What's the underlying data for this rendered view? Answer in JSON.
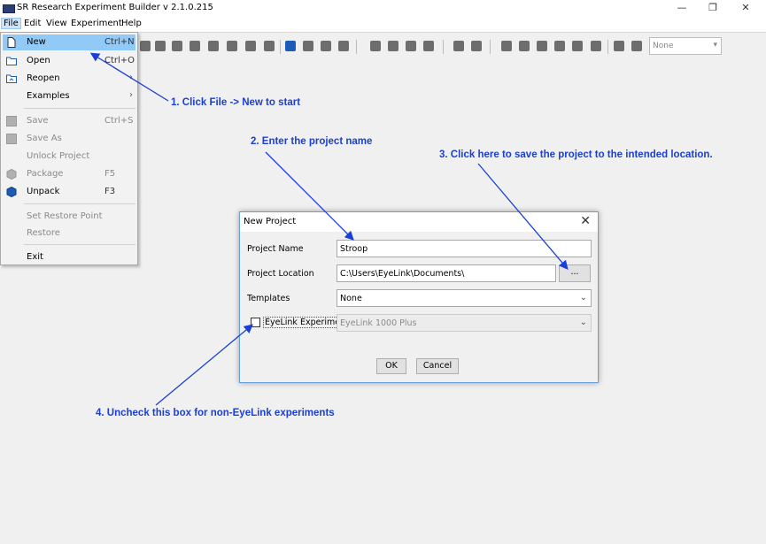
{
  "window": {
    "title": "SR Research Experiment Builder v 2.1.0.215",
    "minimize": "—",
    "maximize": "❐",
    "close": "✕"
  },
  "menubar": [
    "File",
    "Edit",
    "View",
    "Experiment",
    "Help"
  ],
  "toolbar": {
    "combo_value": "None"
  },
  "file_menu": {
    "items": [
      {
        "label": "New",
        "shortcut": "Ctrl+N",
        "icon": "new-document-icon"
      },
      {
        "label": "Open",
        "shortcut": "Ctrl+O",
        "icon": "open-folder-icon"
      },
      {
        "label": "Reopen",
        "submenu": "›",
        "icon": "reopen-icon"
      },
      {
        "label": "Examples",
        "submenu": "›"
      },
      {
        "label": "Save",
        "shortcut": "Ctrl+S",
        "icon": "save-icon"
      },
      {
        "label": "Save As",
        "icon": "save-as-icon"
      },
      {
        "label": "Unlock Project"
      },
      {
        "label": "Package",
        "shortcut": "F5",
        "icon": "package-icon"
      },
      {
        "label": "Unpack",
        "shortcut": "F3",
        "icon": "unpack-icon"
      },
      {
        "label": "Set Restore Point"
      },
      {
        "label": "Restore"
      },
      {
        "label": "Exit"
      }
    ]
  },
  "dialog": {
    "title": "New Project",
    "close": "✕",
    "project_name_label": "Project Name",
    "project_name_value": "Stroop",
    "project_location_label": "Project Location",
    "project_location_value": "C:\\Users\\EyeLink\\Documents\\",
    "browse_label": "...",
    "templates_label": "Templates",
    "templates_value": "None",
    "eyelink_label": "EyeLink Experiment",
    "eyelink_checked": false,
    "tracker_value": "EyeLink 1000 Plus",
    "ok_label": "OK",
    "cancel_label": "Cancel"
  },
  "annotations": {
    "step1": "1. Click File -> New to start",
    "step2": "2. Enter the project name",
    "step3": "3. Click here to save the project to the intended location.",
    "step4": "4. Uncheck this box for non-EyeLink experiments",
    "color": "#1a3fd4"
  }
}
